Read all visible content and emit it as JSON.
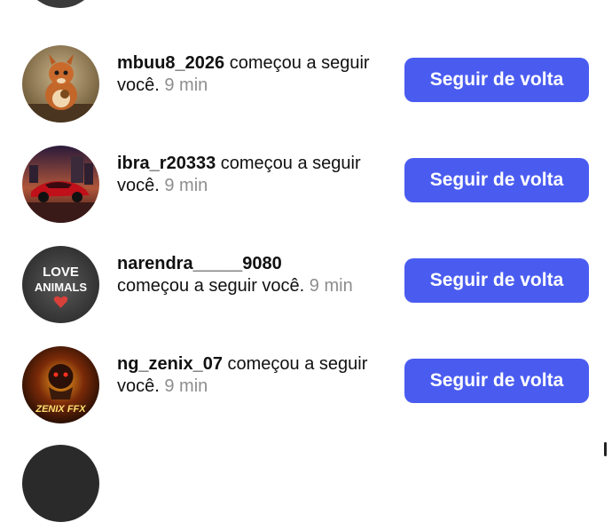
{
  "notifications": [
    {
      "username": "mbuu8_2026",
      "action": "começou a seguir você.",
      "time": "9 min",
      "button_label": "Seguir de volta",
      "avatar_icon": "squirrel-photo"
    },
    {
      "username": "ibra_r20333",
      "action": "começou a seguir você.",
      "time": "9 min",
      "button_label": "Seguir de volta",
      "avatar_icon": "red-sports-car-photo"
    },
    {
      "username": "narendra_____9080",
      "action": "começou a seguir você.",
      "time": "9 min",
      "button_label": "Seguir de volta",
      "avatar_icon": "love-animals-graphic",
      "avatar_text_line1": "LOVE",
      "avatar_text_line2": "ANIMALS"
    },
    {
      "username": "ng_zenix_07",
      "action": "começou a seguir você.",
      "time": "9 min",
      "button_label": "Seguir de volta",
      "avatar_icon": "zenix-ffx-logo",
      "avatar_text": "ZENIX FFX"
    }
  ],
  "colors": {
    "button": "#4a5cf0",
    "muted_text": "#8e8e8e"
  }
}
